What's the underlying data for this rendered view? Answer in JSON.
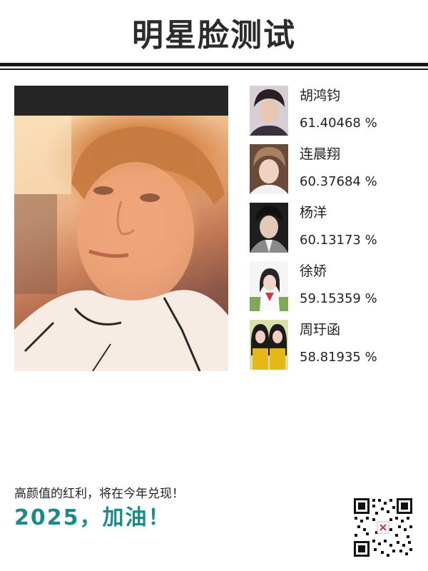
{
  "header": {
    "title": "明星脸测试"
  },
  "matches": [
    {
      "name": "胡鸿钧",
      "score": "61.40468 %"
    },
    {
      "name": "连晨翔",
      "score": "60.37684 %"
    },
    {
      "name": "杨洋",
      "score": "60.13173 %"
    },
    {
      "name": "徐娇",
      "score": "59.15359 %"
    },
    {
      "name": "周玗函",
      "score": "58.81935 %"
    }
  ],
  "footer": {
    "slogan_line1": "高颜值的红利，将在今年兑现！",
    "slogan_line2": "2025，加油！"
  },
  "colors": {
    "accent": "#1d8a8a",
    "rule": "#1a1a1a",
    "band": "#262626"
  }
}
